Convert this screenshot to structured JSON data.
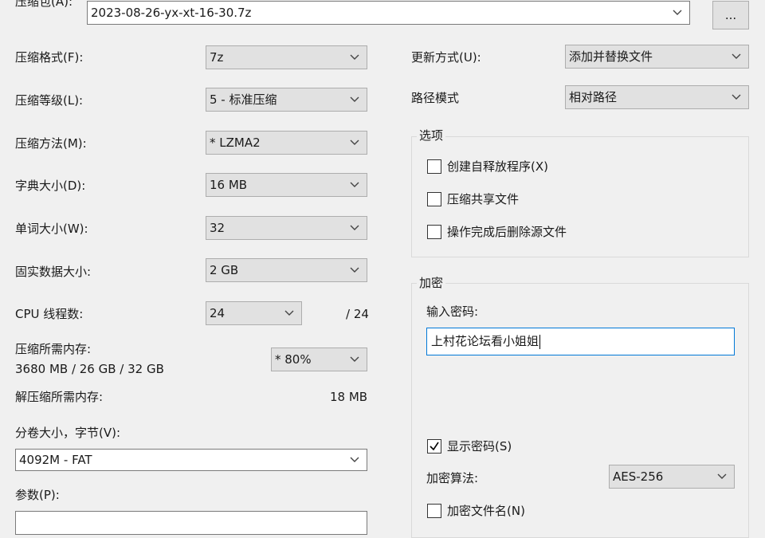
{
  "archive": {
    "label": "压缩包(A):",
    "value": "2023-08-26-yx-xt-16-30.7z",
    "browse_label": "..."
  },
  "left": {
    "format": {
      "label": "压缩格式(F):",
      "value": "7z"
    },
    "level": {
      "label": "压缩等级(L):",
      "value": "5 - 标准压缩"
    },
    "method": {
      "label": "压缩方法(M):",
      "value": "* LZMA2"
    },
    "dict": {
      "label": "字典大小(D):",
      "value": "16 MB"
    },
    "word": {
      "label": "单词大小(W):",
      "value": "32"
    },
    "solid": {
      "label": "固实数据大小:",
      "value": "2 GB"
    },
    "cpu": {
      "label": "CPU 线程数:",
      "value": "24",
      "max": "/ 24"
    },
    "memory": {
      "label": "压缩所需内存:",
      "detail": "3680 MB / 26 GB / 32 GB",
      "value": "* 80%"
    },
    "decompress": {
      "label": "解压缩所需内存:",
      "value": "18 MB"
    },
    "split": {
      "label": "分卷大小，字节(V):",
      "value": "4092M - FAT"
    },
    "params": {
      "label": "参数(P):",
      "value": ""
    }
  },
  "right": {
    "update": {
      "label": "更新方式(U):",
      "value": "添加并替换文件"
    },
    "path": {
      "label": "路径模式",
      "value": "相对路径"
    },
    "options": {
      "title": "选项",
      "sfx": {
        "label": "创建自释放程序(X)",
        "checked": false
      },
      "shared": {
        "label": "压缩共享文件",
        "checked": false
      },
      "delete": {
        "label": "操作完成后删除源文件",
        "checked": false
      }
    },
    "encryption": {
      "title": "加密",
      "password_label": "输入密码:",
      "password_value": "上村花论坛看小姐姐",
      "show_password": {
        "label": "显示密码(S)",
        "checked": true
      },
      "method_label": "加密算法:",
      "method_value": "AES-256",
      "encrypt_names": {
        "label": "加密文件名(N)",
        "checked": false
      }
    }
  },
  "colors": {
    "background": "#f0f0f0",
    "combo": "#e1e1e1",
    "focus": "#0078d7"
  }
}
